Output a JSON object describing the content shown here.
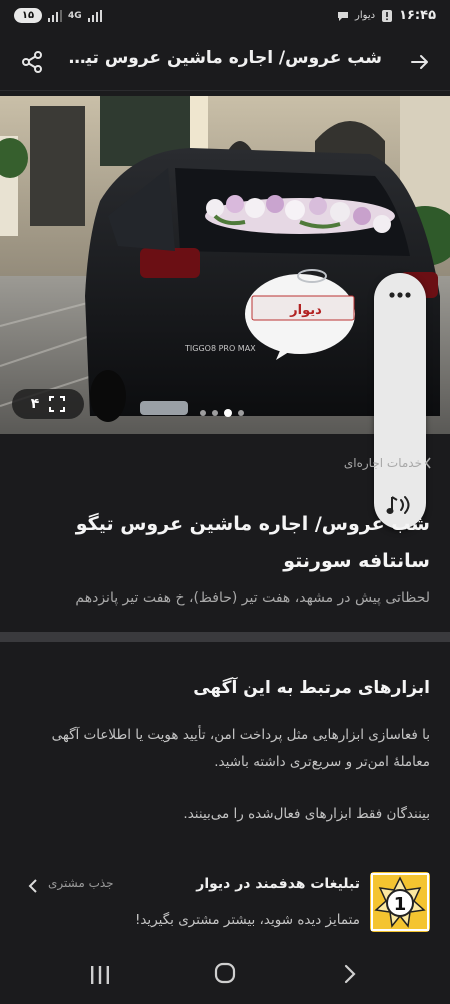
{
  "status_bar": {
    "battery": "۱۵",
    "network": "4G",
    "app_label": "دیوار",
    "time": "۱۶:۴۵"
  },
  "app_bar": {
    "title": "شب عروس/ اجاره ماشین عروس تیگو...",
    "back_icon": "arrow-right-icon",
    "share_icon": "share-icon"
  },
  "gallery": {
    "photo_count": "۴",
    "plate_text": "دیوار",
    "car_badge": "TIGGO8 PRO MAX",
    "dot_count": 4,
    "active_dot": 3
  },
  "breadcrumb": {
    "label": "خدمات اجاره‌ای"
  },
  "post": {
    "title": "شب عروس/ اجاره ماشین عروس تیگو سانتافه سورنتو",
    "meta": "لحظاتی پیش در مشهد، هفت تیر (حافظ)، خ هفت تیر پانزدهم"
  },
  "tools": {
    "heading": "ابزارهای مرتبط به این آگهی",
    "description": "با فعاسازی ابزارهایی مثل پرداخت امن، تأیید هویت یا اطلاعات آگهی معاملهٔ امن‌تر و سریع‌تری داشته باشید.",
    "note": "بینندگان فقط ابزارهای فعال‌شده را می‌بینند.",
    "item": {
      "title": "تبلیغات هدفمند در دیوار",
      "subtitle": "متمایز دیده شوید، بیشتر مشتری بگیرید!",
      "tag": "جذب مشتری",
      "badge_number": "1"
    }
  },
  "colors": {
    "background": "#1b1b1d",
    "divider": "#3a3a3d",
    "badge_yellow": "#f4c430"
  }
}
